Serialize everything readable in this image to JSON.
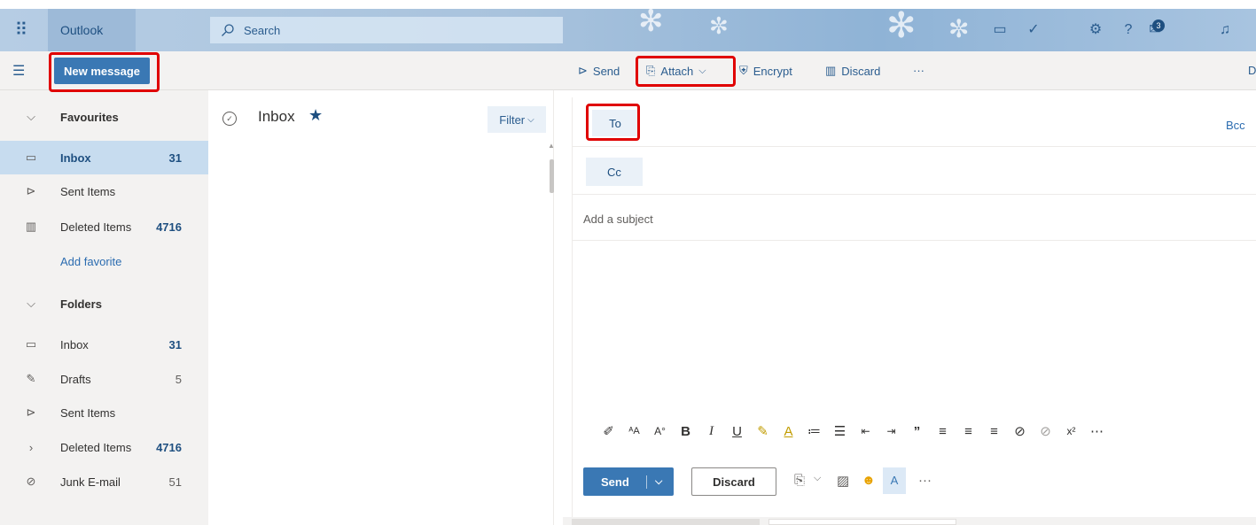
{
  "topbar": {
    "app_name": "Outlook",
    "search_placeholder": "Search",
    "notification_count": "3"
  },
  "toolbar": {
    "new_message": "New message",
    "send": "Send",
    "attach": "Attach",
    "encrypt": "Encrypt",
    "discard": "Discard",
    "more": "···",
    "right_cut": "D"
  },
  "nav": {
    "favourites": "Favourites",
    "fav_items": [
      {
        "label": "Inbox",
        "count": "31"
      },
      {
        "label": "Sent Items",
        "count": ""
      },
      {
        "label": "Deleted Items",
        "count": "4716"
      }
    ],
    "add_favorite": "Add favorite",
    "folders": "Folders",
    "folder_items": [
      {
        "label": "Inbox",
        "count": "31"
      },
      {
        "label": "Drafts",
        "count": "5"
      },
      {
        "label": "Sent Items",
        "count": ""
      },
      {
        "label": "Deleted Items",
        "count": "4716"
      },
      {
        "label": "Junk E-mail",
        "count": "51"
      }
    ]
  },
  "list": {
    "title": "Inbox",
    "filter": "Filter"
  },
  "compose": {
    "to": "To",
    "cc": "Cc",
    "bcc": "Bcc",
    "subject_placeholder": "Add a subject",
    "send": "Send",
    "discard": "Discard",
    "more": "···"
  },
  "colors": {
    "accent": "#3a78b4",
    "highlight_box": "#e00000",
    "nav_selected": "#c7dcef"
  }
}
